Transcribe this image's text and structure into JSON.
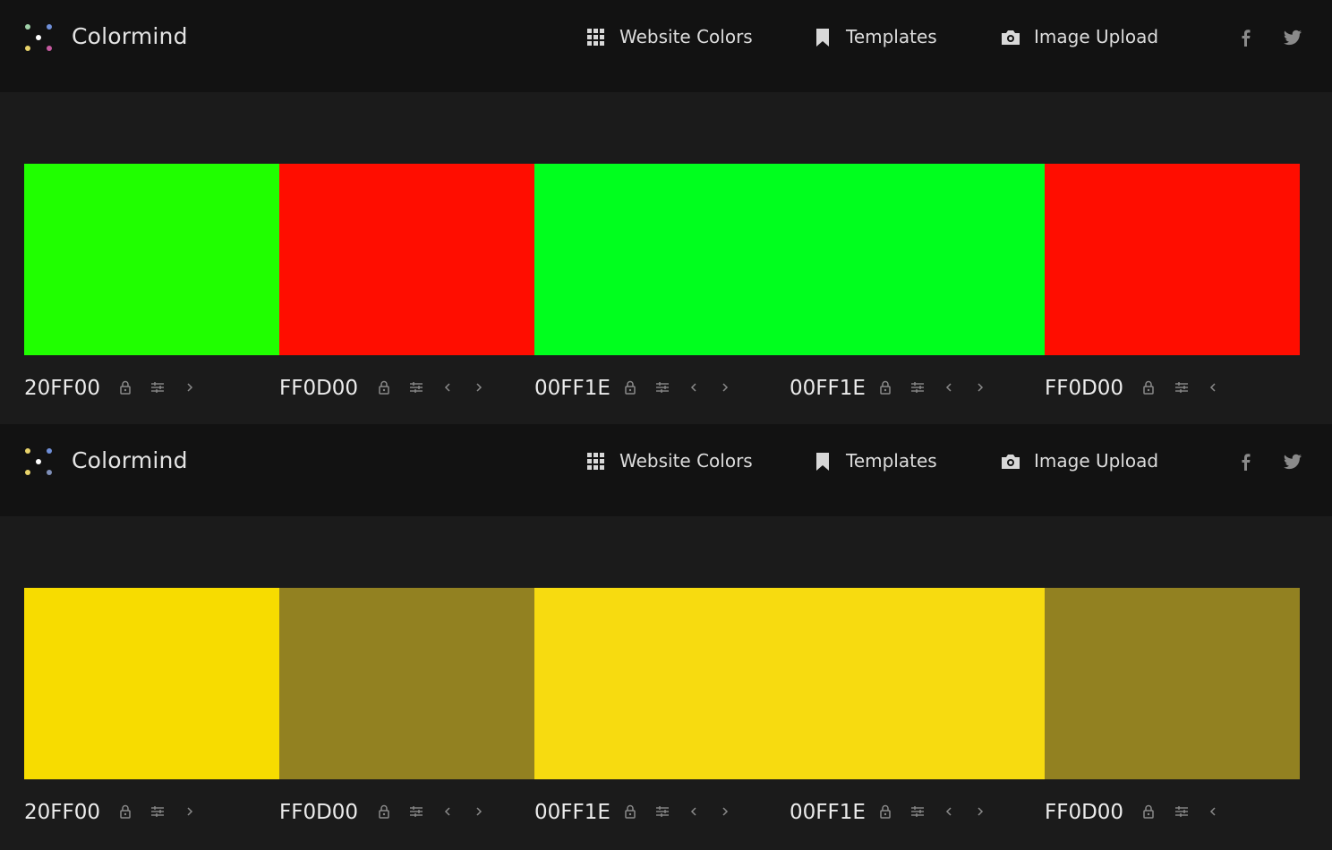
{
  "navbar": {
    "brand": "Colormind",
    "logo_icon": "colormind-logo-icon",
    "nav": [
      {
        "label": "Website Colors",
        "icon": "grid-icon"
      },
      {
        "label": "Templates",
        "icon": "bookmark-icon"
      },
      {
        "label": "Image Upload",
        "icon": "camera-icon"
      }
    ],
    "social": [
      {
        "icon": "facebook-icon"
      },
      {
        "icon": "twitter-icon"
      }
    ]
  },
  "palettes": [
    {
      "swatches": [
        {
          "hex": "20FF00",
          "color": "#20FF00"
        },
        {
          "hex": "FF0D00",
          "color": "#FF0D00"
        },
        {
          "hex": "00FF1E",
          "color": "#00FF1E"
        },
        {
          "hex": "00FF1E",
          "color": "#00FF1E"
        },
        {
          "hex": "FF0D00",
          "color": "#FF0D00"
        }
      ]
    },
    {
      "swatches": [
        {
          "hex": "20FF00",
          "color": "#F7DC00"
        },
        {
          "hex": "FF0D00",
          "color": "#928121"
        },
        {
          "hex": "00FF1E",
          "color": "#F7DB10"
        },
        {
          "hex": "00FF1E",
          "color": "#F7DB10"
        },
        {
          "hex": "FF0D00",
          "color": "#928121"
        }
      ]
    }
  ],
  "tool_icons": {
    "lock": "lock-icon",
    "adjust": "sliders-icon",
    "left": "chevron-left-icon",
    "right": "chevron-right-icon"
  },
  "colors": {
    "navbar_bg": "#121212",
    "page_bg": "#1b1b1b",
    "text": "#e6e6e6",
    "icon": "#8a8a8a"
  }
}
